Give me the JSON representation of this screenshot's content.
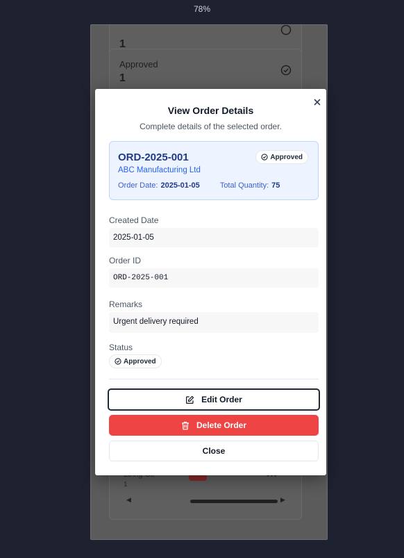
{
  "zoom": "78%",
  "background_cards": [
    {
      "label": "",
      "count": "1",
      "icon": "clock-icon"
    },
    {
      "label": "Approved",
      "count": "1",
      "icon": "check-circle-icon"
    }
  ],
  "background_row": {
    "name": "Ltring Co",
    "sub": "1"
  },
  "modal": {
    "title": "View Order Details",
    "subtitle": "Complete details of the selected order.",
    "summary": {
      "order_id": "ORD-2025-001",
      "company": "ABC Manufacturing Ltd",
      "status": "Approved",
      "order_date_label": "Order Date:",
      "order_date": "2025-01-05",
      "total_qty_label": "Total Quantity:",
      "total_qty": "75"
    },
    "fields": {
      "created_date_label": "Created Date",
      "created_date": "2025-01-05",
      "order_id_label": "Order ID",
      "order_id": "ORD-2025-001",
      "remarks_label": "Remarks",
      "remarks": "Urgent delivery required",
      "status_label": "Status",
      "status": "Approved"
    },
    "buttons": {
      "edit": "Edit Order",
      "delete": "Delete Order",
      "close": "Close"
    }
  },
  "colors": {
    "accent_blue": "#1e3a8a",
    "delete_red": "#ef4444",
    "summary_bg": "#eef4ff"
  }
}
